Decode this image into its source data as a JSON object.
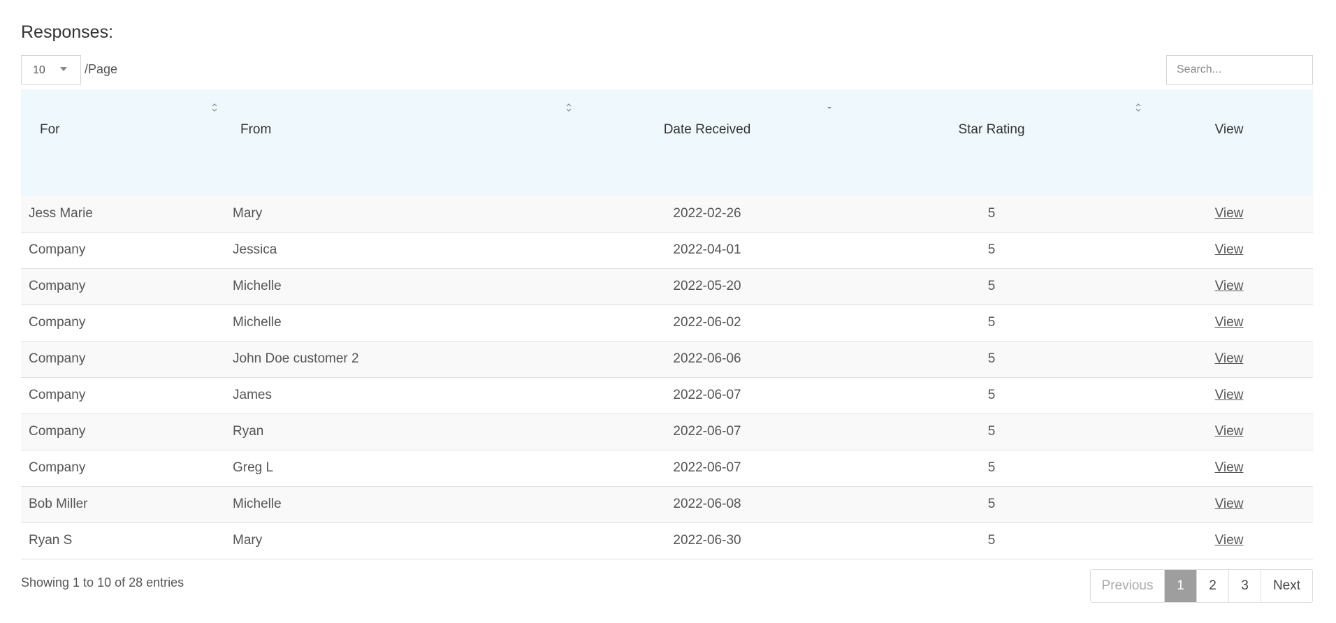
{
  "heading": "Responses:",
  "page_size": {
    "value": "10",
    "suffix": "/Page"
  },
  "search": {
    "placeholder": "Search...",
    "value": ""
  },
  "table": {
    "columns": [
      "For",
      "From",
      "Date Received",
      "Star Rating",
      "View"
    ],
    "sorted_column": "Date Received",
    "rows": [
      {
        "for": "Jess Marie",
        "from": "Mary",
        "date": "2022-02-26",
        "rating": "5",
        "view": "View"
      },
      {
        "for": "Company",
        "from": "Jessica",
        "date": "2022-04-01",
        "rating": "5",
        "view": "View"
      },
      {
        "for": "Company",
        "from": "Michelle",
        "date": "2022-05-20",
        "rating": "5",
        "view": "View"
      },
      {
        "for": "Company",
        "from": "Michelle",
        "date": "2022-06-02",
        "rating": "5",
        "view": "View"
      },
      {
        "for": "Company",
        "from": "John Doe customer 2",
        "date": "2022-06-06",
        "rating": "5",
        "view": "View"
      },
      {
        "for": "Company",
        "from": "James",
        "date": "2022-06-07",
        "rating": "5",
        "view": "View"
      },
      {
        "for": "Company",
        "from": "Ryan",
        "date": "2022-06-07",
        "rating": "5",
        "view": "View"
      },
      {
        "for": "Company",
        "from": "Greg L",
        "date": "2022-06-07",
        "rating": "5",
        "view": "View"
      },
      {
        "for": "Bob Miller",
        "from": "Michelle",
        "date": "2022-06-08",
        "rating": "5",
        "view": "View"
      },
      {
        "for": "Ryan S",
        "from": "Mary",
        "date": "2022-06-30",
        "rating": "5",
        "view": "View"
      }
    ]
  },
  "info": "Showing 1 to 10 of 28 entries",
  "pagination": {
    "previous": "Previous",
    "pages": [
      "1",
      "2",
      "3"
    ],
    "current": "1",
    "next": "Next"
  },
  "colors": {
    "header_bg": "#eff8fc",
    "active_page_bg": "#9e9e9e",
    "row_stripe": "#f9f9f9"
  }
}
